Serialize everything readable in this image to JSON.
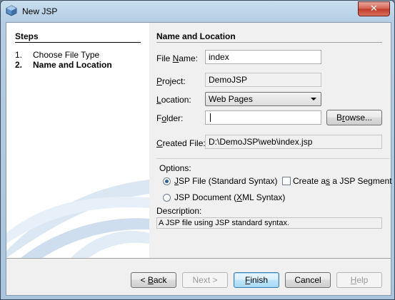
{
  "window": {
    "title": "New JSP",
    "close_label": "✕"
  },
  "steps": {
    "title": "Steps",
    "items": [
      {
        "num": "1.",
        "label": "Choose File Type"
      },
      {
        "num": "2.",
        "label": "Name and Location"
      }
    ]
  },
  "panel": {
    "title": "Name and Location",
    "file_name": {
      "label_pre": "File ",
      "label_u": "N",
      "label_post": "ame:",
      "value": "index"
    },
    "project": {
      "label_pre": "",
      "label_u": "P",
      "label_post": "roject:",
      "value": "DemoJSP"
    },
    "location": {
      "label_pre": "",
      "label_u": "L",
      "label_post": "ocation:",
      "value": "Web Pages"
    },
    "folder": {
      "label_pre": "F",
      "label_u": "o",
      "label_post": "lder:",
      "value": ""
    },
    "browse": {
      "label_pre": "B",
      "label_u": "r",
      "label_post": "owse..."
    },
    "created_file": {
      "label_pre": "",
      "label_u": "C",
      "label_post": "reated File:",
      "value": "D:\\DemoJSP\\web\\index.jsp"
    }
  },
  "options": {
    "title": "Options:",
    "jsp_file": {
      "label_pre": "",
      "label_u": "J",
      "label_post": "SP File (Standard Syntax)",
      "selected": true
    },
    "jsp_document": {
      "label_pre": "JSP Document (",
      "label_u": "X",
      "label_post": "ML Syntax)",
      "selected": false
    },
    "segment": {
      "label_pre": "Create a",
      "label_u": "s",
      "label_post": " a JSP Segment",
      "checked": false
    },
    "description_label": "Description:",
    "description": "A JSP file using JSP standard syntax."
  },
  "buttons": {
    "back": {
      "pre": "< ",
      "u": "B",
      "post": "ack"
    },
    "next": {
      "pre": "Next >",
      "u": "",
      "post": ""
    },
    "finish": {
      "pre": "",
      "u": "F",
      "post": "inish"
    },
    "cancel": {
      "pre": "Cancel",
      "u": "",
      "post": ""
    },
    "help": {
      "pre": "",
      "u": "H",
      "post": "elp"
    }
  }
}
